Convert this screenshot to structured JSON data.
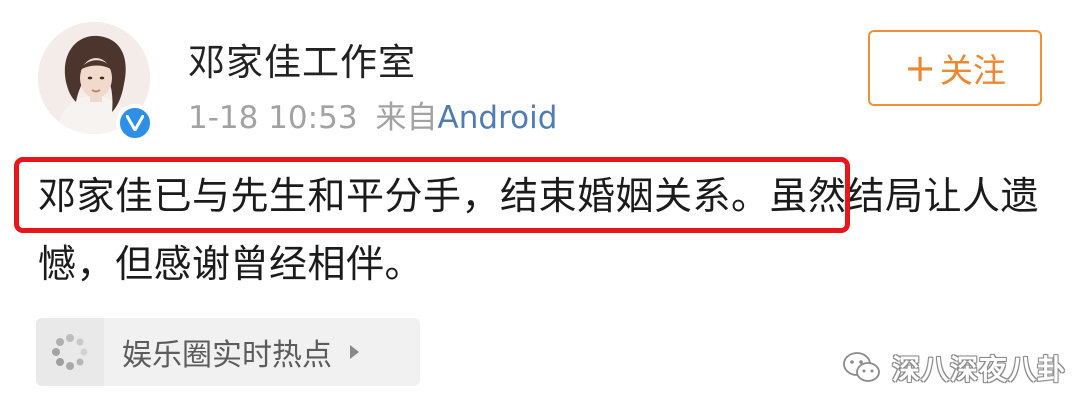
{
  "post": {
    "author": "邓家佳工作室",
    "time": "1-18 10:53",
    "from_label": "来自",
    "source": "Android",
    "text_highlighted": "邓家佳已与先生和平分手，结束婚姻关系。",
    "text_rest": "虽然结局让人遗憾，但感谢曾经相伴。"
  },
  "follow_button": {
    "plus": "+",
    "label": "关注"
  },
  "topic": {
    "label": "娱乐圈实时热点",
    "icon": "dots-loader-icon"
  },
  "watermark": {
    "icon": "wechat-icon",
    "text": "深八深夜八卦"
  },
  "colors": {
    "accent_orange": "#f09035",
    "link_blue": "#507daf",
    "verified_blue": "#2d8fe5",
    "highlight_red": "#e6161c",
    "meta_gray": "#a2a2a2"
  }
}
